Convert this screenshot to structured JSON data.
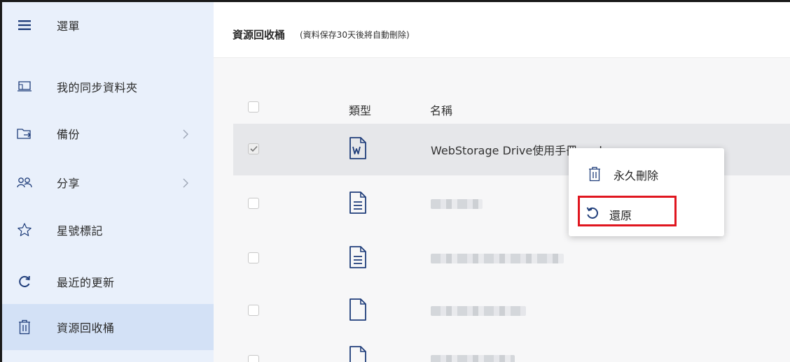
{
  "sidebar": {
    "menu_label": "選單",
    "items": [
      {
        "label": "我的同步資料夾",
        "icon": "laptop-folder-icon"
      },
      {
        "label": "備份",
        "icon": "backup-folder-icon",
        "has_submenu": true
      },
      {
        "label": "分享",
        "icon": "share-people-icon",
        "has_submenu": true
      },
      {
        "label": "星號標記",
        "icon": "star-icon"
      },
      {
        "label": "最近的更新",
        "icon": "refresh-icon"
      },
      {
        "label": "資源回收桶",
        "icon": "trash-icon",
        "active": true
      }
    ]
  },
  "header": {
    "title": "資源回收桶",
    "note": "(資料保存30天後將自動刪除)"
  },
  "table": {
    "columns": [
      "類型",
      "名稱"
    ],
    "rows": [
      {
        "type_icon": "word-document-icon",
        "name": "WebStorage Drive使用手冊... .d",
        "selected": true
      },
      {
        "type_icon": "text-document-icon",
        "name": "",
        "blurred": true,
        "selected": false
      },
      {
        "type_icon": "text-document-icon",
        "name": "",
        "blurred": true,
        "selected": false
      },
      {
        "type_icon": "blank-document-icon",
        "name": "",
        "blurred": true,
        "selected": false
      },
      {
        "type_icon": "blank-document-icon",
        "name": "",
        "blurred": true,
        "selected": false
      }
    ]
  },
  "context_menu": {
    "items": [
      {
        "label": "永久刪除",
        "icon": "trash-icon"
      },
      {
        "label": "還原",
        "icon": "restore-icon",
        "highlighted": true
      }
    ]
  },
  "colors": {
    "sidebar_bg": "#e9f0fb",
    "sidebar_active": "#d3e1f6",
    "highlight_border": "#e0161f",
    "selected_row": "#e6e7ea"
  }
}
